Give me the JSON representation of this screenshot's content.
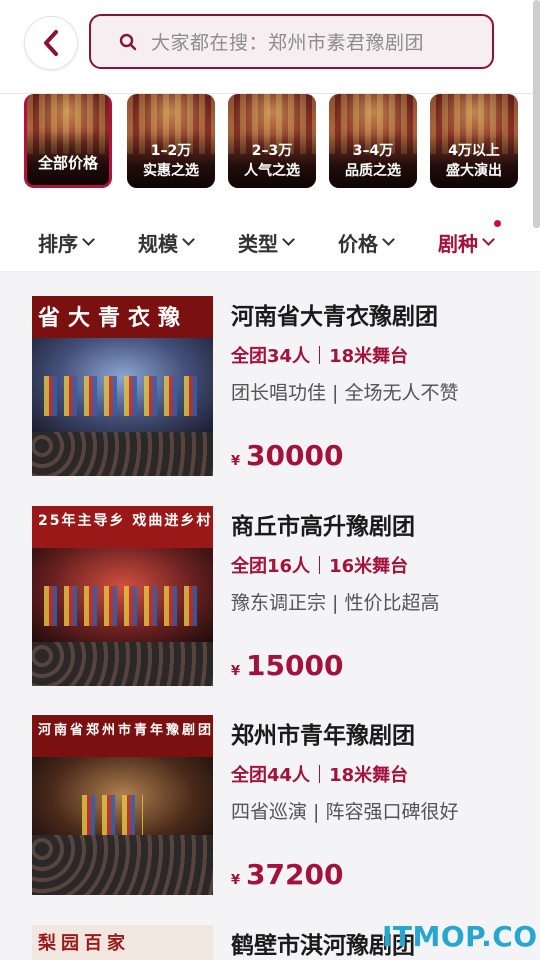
{
  "search": {
    "placeholder": "大家都在搜：郑州市素君豫剧团"
  },
  "price_filters": [
    {
      "line1": "全部价格",
      "line2": ""
    },
    {
      "line1": "1–2万",
      "line2": "实惠之选"
    },
    {
      "line1": "2–3万",
      "line2": "人气之选"
    },
    {
      "line1": "3–4万",
      "line2": "品质之选"
    },
    {
      "line1": "4万以上",
      "line2": "盛大演出"
    }
  ],
  "filters": [
    {
      "label": "排序"
    },
    {
      "label": "规模"
    },
    {
      "label": "类型"
    },
    {
      "label": "价格"
    },
    {
      "label": "剧种"
    }
  ],
  "listings": [
    {
      "title": "河南省大青衣豫剧团",
      "members": "全团34人",
      "stage": "18米舞台",
      "desc": "团长唱功佳 | 全场无人不赞",
      "currency": "¥",
      "price": "30000",
      "banner": "省大青衣豫"
    },
    {
      "title": "商丘市高升豫剧团",
      "members": "全团16人",
      "stage": "16米舞台",
      "desc": "豫东调正宗 | 性价比超高",
      "currency": "¥",
      "price": "15000",
      "banner": "25年主导乡 戏曲进乡村"
    },
    {
      "title": "郑州市青年豫剧团",
      "members": "全团44人",
      "stage": "18米舞台",
      "desc": "四省巡演 | 阵容强口碑很好",
      "currency": "¥",
      "price": "37200",
      "banner": "河南省郑州市青年豫剧团"
    },
    {
      "title": "鹤壁市淇河豫剧团",
      "members": "",
      "stage": "",
      "desc": "",
      "currency": "",
      "price": "",
      "banner": "梨园百家"
    }
  ],
  "watermark": "ITMOP.COM",
  "colors": {
    "accent": "#a3123a",
    "border": "#8a1232"
  },
  "icons": {
    "back": "chevron-left-icon",
    "search": "search-icon",
    "dropdown": "chevron-down-icon"
  }
}
